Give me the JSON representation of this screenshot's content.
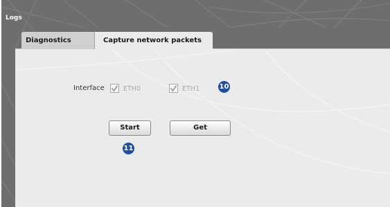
{
  "window": {
    "title": "Logs"
  },
  "tabs": [
    {
      "label": "Diagnostics",
      "active": false
    },
    {
      "label": "Capture network packets",
      "active": true
    }
  ],
  "interface": {
    "label": "Interface",
    "options": [
      {
        "label": "ETH0",
        "checked": true
      },
      {
        "label": "ETH1",
        "checked": true
      }
    ]
  },
  "buttons": {
    "start": "Start",
    "get": "Get"
  },
  "markers": {
    "interface": "10",
    "start": "11"
  },
  "colors": {
    "marker": "#1f4f9e",
    "frame": "#6e6e6e",
    "panel": "#ebebeb"
  }
}
